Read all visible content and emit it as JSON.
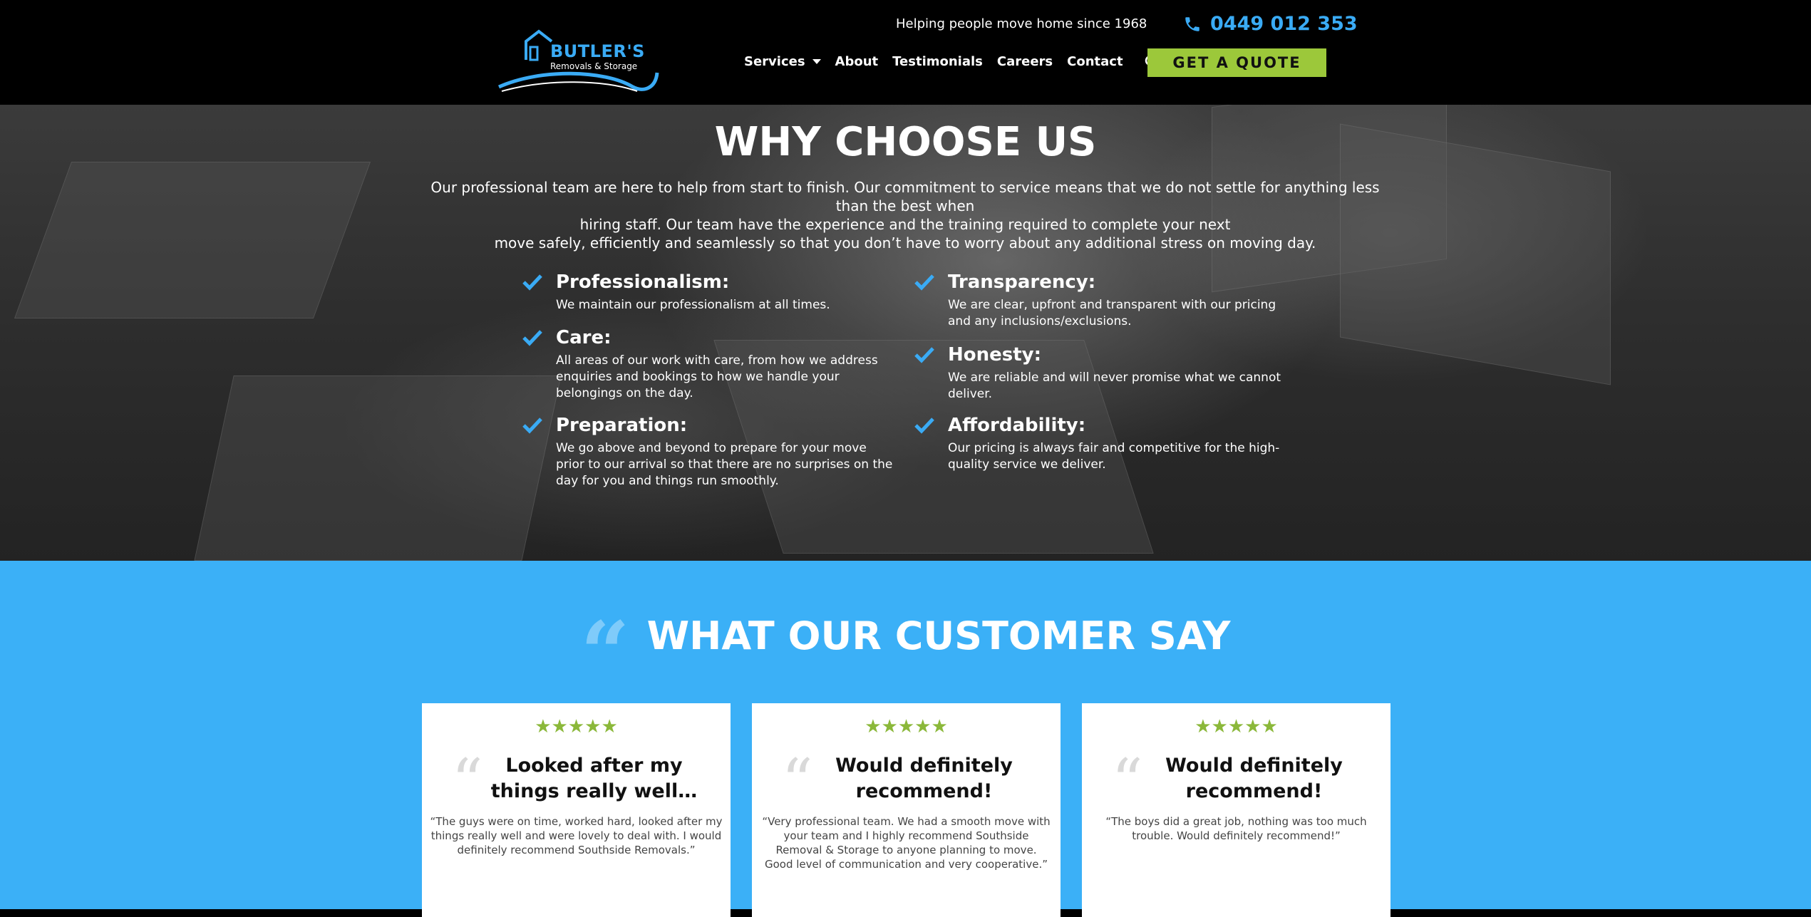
{
  "header": {
    "logo_name": "BUTLER'S",
    "logo_sub": "Removals & Storage",
    "tagline": "Helping people move home since 1968",
    "phone": "0449 012 353",
    "nav": [
      {
        "label": "Services"
      },
      {
        "label": "About"
      },
      {
        "label": "Testimonials"
      },
      {
        "label": "Careers"
      },
      {
        "label": "Contact"
      }
    ],
    "quote_button": "GET A QUOTE",
    "icons": {
      "phone": "phone-icon",
      "search": "search-icon",
      "dropdown": "chevron-down-icon"
    },
    "colors": {
      "accent_blue": "#3aabf5",
      "button_green": "#9cc83a"
    }
  },
  "why": {
    "title": "WHY CHOOSE US",
    "intro_line1": "Our professional team are here to help from start to finish. Our commitment to service means that we do not settle for anything less than the best when",
    "intro_line2": "hiring staff. Our team have the experience and the training required to complete your next",
    "intro_line3": "move safely, efficiently and seamlessly so that you don’t have to worry about any additional stress on moving day.",
    "features": [
      {
        "title": "Professionalism:",
        "desc": "We maintain our professionalism at all times."
      },
      {
        "title": "Transparency:",
        "desc": "We are clear, upfront and transparent with our pricing and any inclusions/exclusions."
      },
      {
        "title": "Care:",
        "desc": "All areas of our work with care, from how we address enquiries and bookings to how we handle your belongings on the day."
      },
      {
        "title": "Honesty:",
        "desc": "We are reliable and will never promise what we cannot deliver."
      },
      {
        "title": "Preparation:",
        "desc": "We go above and beyond to prepare for your move prior to our arrival so that there are no surprises on the day for you and things run smoothly."
      },
      {
        "title": "Affordability:",
        "desc": "Our pricing is always fair and competitive for the high-quality service we deliver."
      }
    ],
    "check_color": "#3aabf5"
  },
  "testimonials": {
    "quote_mark": "“",
    "title": "WHAT OUR CUSTOMER SAY",
    "background": "#3bb0f7",
    "star_color": "#8bb83a",
    "cards": [
      {
        "rating": 5,
        "stars": "★★★★★",
        "title": "Looked after my things really well…",
        "text": "“The guys were on time, worked hard, looked after my things really well and were lovely to deal with. I would definitely recommend Southside Removals.”"
      },
      {
        "rating": 5,
        "stars": "★★★★★",
        "title": "Would definitely recommend!",
        "text": "“Very professional team. We had a smooth move with your team and I highly recommend Southside Removal & Storage to anyone planning to move. Good level of communication and very cooperative.”"
      },
      {
        "rating": 5,
        "stars": "★★★★★",
        "title": "Would definitely recommend!",
        "text": "“The boys did a great job, nothing was too much trouble. Would definitely recommend!”"
      }
    ]
  }
}
